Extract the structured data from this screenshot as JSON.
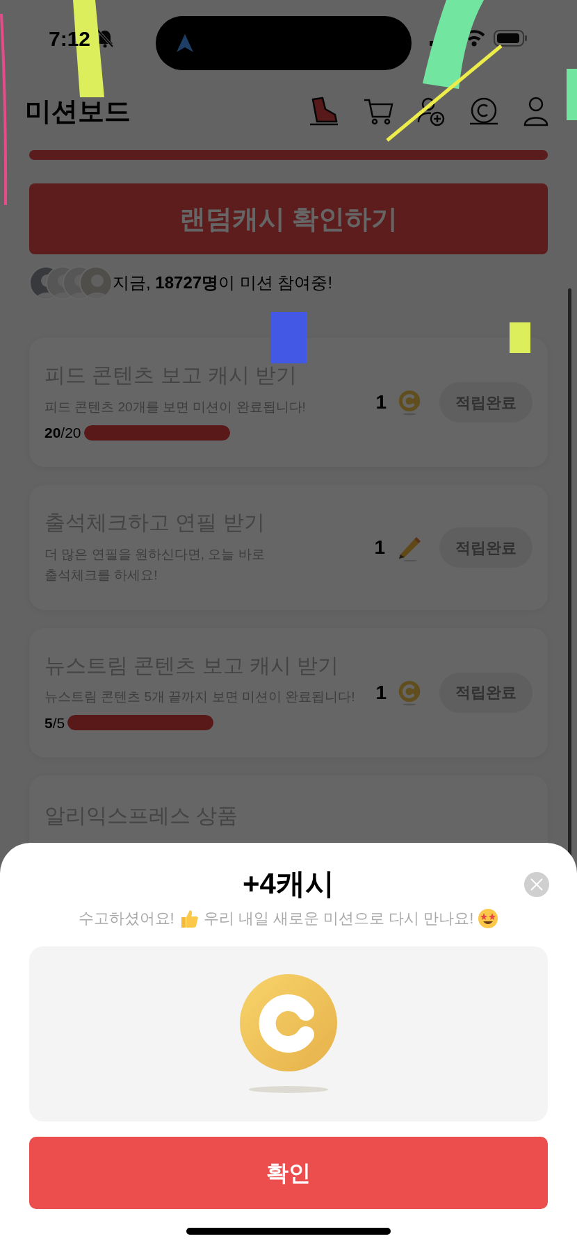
{
  "status_bar": {
    "time": "7:12"
  },
  "header": {
    "title": "미션보드"
  },
  "random_cash_button": "랜덤캐시 확인하기",
  "participants": {
    "text": "지금, **18727명**이 미션 참여중!"
  },
  "missions": [
    {
      "title": "피드 콘텐츠 보고 캐시 받기",
      "description": "피드 콘텐츠 20개를 보면 미션이 완료됩니다!",
      "progress": "**20**/20",
      "level": 1,
      "reward": {
        "count": "1",
        "kind": "coin"
      },
      "button": "적립완료"
    },
    {
      "title": "출석체크하고 연필 받기",
      "description": "더 많은 연필을 원하신다면, 오늘 바로\n출석체크를 하세요!",
      "reward": {
        "count": "1",
        "kind": "pencil"
      },
      "button": "적립완료"
    },
    {
      "title": "뉴스트림 콘텐츠 보고 캐시 받기",
      "description": "뉴스트림 콘텐츠 5개 끝까지 보면 미션이 완료됩니다!",
      "progress": "**5**/5",
      "level": 1,
      "reward": {
        "count": "1",
        "kind": "coin"
      },
      "button": "적립완료"
    },
    {
      "title": "알리익스프레스 상품"
    }
  ],
  "sheet": {
    "title": "+4캐시",
    "message_start": "수고하셨어요!",
    "message_end": "우리 내일 새로운 미션으로 다시 만나요!",
    "confirm_button": "확인"
  }
}
